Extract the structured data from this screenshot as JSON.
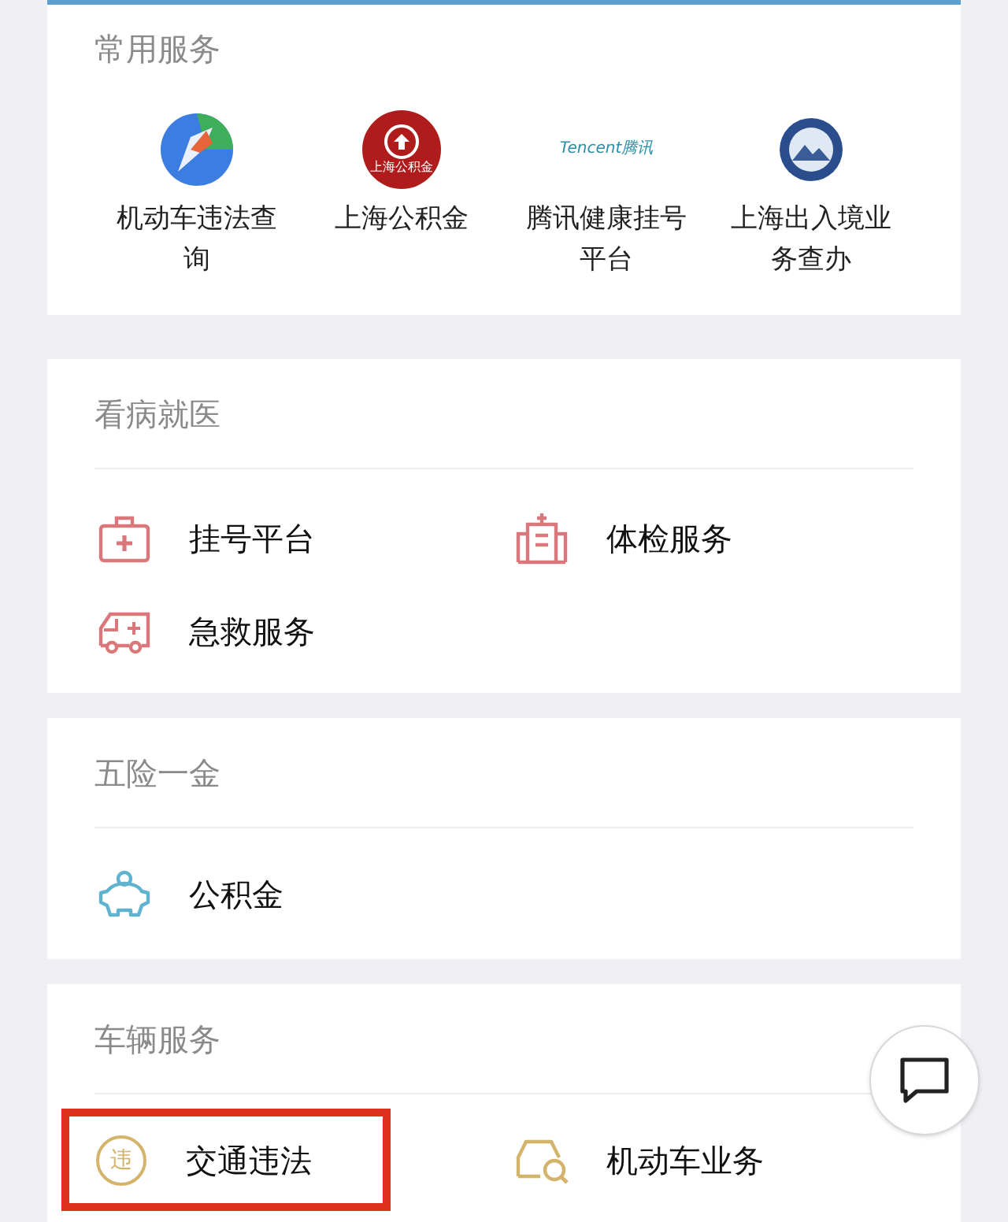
{
  "sections": [
    {
      "title": "常用服务",
      "kind": "grid",
      "items": [
        {
          "label": "机动车违法查询",
          "kind": "map"
        },
        {
          "label": "上海公积金",
          "kind": "fund",
          "logo_text": "上海公积金"
        },
        {
          "label": "腾讯健康挂号平台",
          "kind": "tencent",
          "logo_text": "Tencent腾讯"
        },
        {
          "label": "上海出入境业务查办",
          "kind": "emblem"
        }
      ]
    },
    {
      "title": "看病就医",
      "kind": "list",
      "items": [
        {
          "label": "挂号平台",
          "kind": "kit",
          "color": "#d9777b",
          "highlighted": false
        },
        {
          "label": "体检服务",
          "kind": "hospital",
          "color": "#d9777b",
          "highlighted": false
        },
        {
          "label": "急救服务",
          "kind": "ambulance",
          "color": "#d9777b",
          "highlighted": false
        }
      ]
    },
    {
      "title": "五险一金",
      "kind": "list",
      "items": [
        {
          "label": "公积金",
          "kind": "piggy",
          "color": "#5fb3cf",
          "highlighted": false
        }
      ]
    },
    {
      "title": "车辆服务",
      "kind": "list",
      "items": [
        {
          "label": "交通违法",
          "kind": "badge",
          "icon_char": "违",
          "color": "#d4b46a",
          "highlighted": true
        },
        {
          "label": "机动车业务",
          "kind": "car",
          "color": "#d4b46a",
          "highlighted": false
        }
      ]
    }
  ]
}
